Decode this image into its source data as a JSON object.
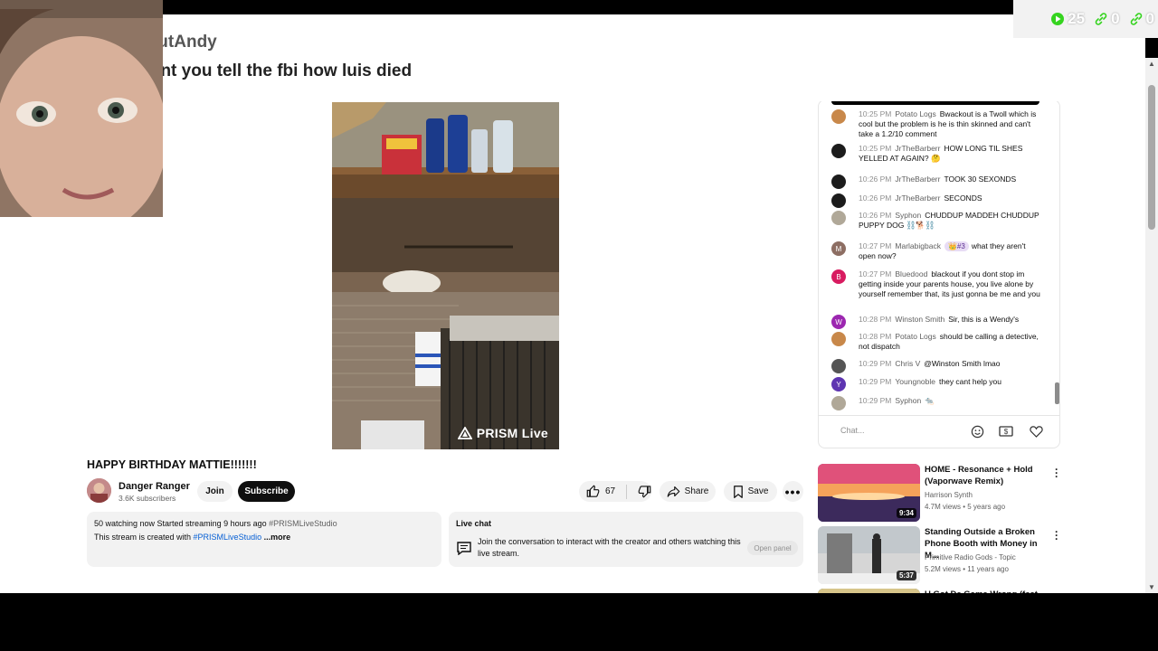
{
  "overlay": {
    "username": "BlackoutAndy",
    "message": "why dont you tell the fbi how luis died",
    "stats": [
      {
        "icon": "play-icon",
        "value": "25"
      },
      {
        "icon": "link-icon",
        "value": "0"
      },
      {
        "icon": "link-icon",
        "value": "0"
      }
    ]
  },
  "video": {
    "watermark": "PRISM Live",
    "title": "HAPPY BIRTHDAY MATTIE!!!!!!!"
  },
  "channel": {
    "name": "Danger Ranger",
    "subscribers": "3.6K subscribers",
    "join_label": "Join",
    "subscribe_label": "Subscribe"
  },
  "actions": {
    "like_count": "67",
    "share_label": "Share",
    "save_label": "Save"
  },
  "description": {
    "stats_line": "50 watching now  Started streaming 9 hours ago",
    "hashtag_1": "#PRISMLiveStudio",
    "body_prefix": "This stream is created with ",
    "hashtag_2": "#PRISMLiveStudio",
    "more_label": "...more"
  },
  "live_chat_panel": {
    "heading": "Live chat",
    "text": "Join the conversation to interact with the creator and others watching this live stream.",
    "open_label": "Open panel"
  },
  "chat": {
    "input_placeholder": "Chat...",
    "messages": [
      {
        "time": "10:25 PM",
        "author": "Potato Logs",
        "text": "Bwackout is a Twoll which is cool but the problem is he is thin skinned and can't take a 1.2/10 comment",
        "avatar_color": "#c8884a"
      },
      {
        "time": "10:25 PM",
        "author": "JrTheBarberr",
        "text": "HOW LONG TIL SHES YELLED AT AGAIN? 🤔",
        "avatar_color": "#1c1c1c"
      },
      {
        "time": "10:26 PM",
        "author": "JrTheBarberr",
        "text": "TOOK 30 SEXONDS",
        "avatar_color": "#1c1c1c"
      },
      {
        "time": "10:26 PM",
        "author": "JrTheBarberr",
        "text": "SECONDS",
        "avatar_color": "#1c1c1c"
      },
      {
        "time": "10:26 PM",
        "author": "Syphon",
        "text": "CHUDDUP MADDEH CHUDDUP PUPPY DOG ⛓️🐕⛓️",
        "avatar_color": "#b0a898"
      },
      {
        "time": "10:27 PM",
        "author": "Marlabigback",
        "badge": "👑#3",
        "text": "what they aren't open now?",
        "avatar_color": "#8d6e63",
        "avatar_letter": "M"
      },
      {
        "time": "10:27 PM",
        "author": "Bluedood",
        "text": "blackout if you dont stop im getting inside your parents house, you live alone by yourself remember that, its just gonna be me and you",
        "avatar_color": "#d81b60",
        "avatar_letter": "B"
      },
      {
        "time": "10:28 PM",
        "author": "Winston Smith",
        "text": "Sir, this is a Wendy's",
        "avatar_color": "#9c27b0",
        "avatar_letter": "W"
      },
      {
        "time": "10:28 PM",
        "author": "Potato Logs",
        "text": "should be calling a detective, not dispatch",
        "avatar_color": "#c8884a"
      },
      {
        "time": "10:29 PM",
        "author": "Chris V",
        "text": "@Winston Smith lmao",
        "avatar_color": "#555555"
      },
      {
        "time": "10:29 PM",
        "author": "Youngnoble",
        "text": "they cant help you",
        "avatar_color": "#5e35b1",
        "avatar_letter": "Y"
      },
      {
        "time": "10:29 PM",
        "author": "Syphon",
        "text": "🐀",
        "avatar_color": "#b0a898"
      }
    ]
  },
  "recommendations": [
    {
      "title": "HOME - Resonance + Hold (Vaporwave Remix)",
      "channel": "Harrison Synth",
      "meta": "4.7M views • 5 years ago",
      "duration": "9:34"
    },
    {
      "title": "Standing Outside a Broken Phone Booth with Money in M...",
      "channel": "Primitive Radio Gods - Topic",
      "meta": "5.2M views • 11 years ago",
      "duration": "5:37"
    },
    {
      "title": "U Got De Game Wrong (feat. La",
      "channel": "",
      "meta": "",
      "duration": ""
    }
  ],
  "colors": {
    "overlay_accent": "#2ecc40",
    "subscribe_bg": "#0f0f0f",
    "link": "#065fd4"
  }
}
